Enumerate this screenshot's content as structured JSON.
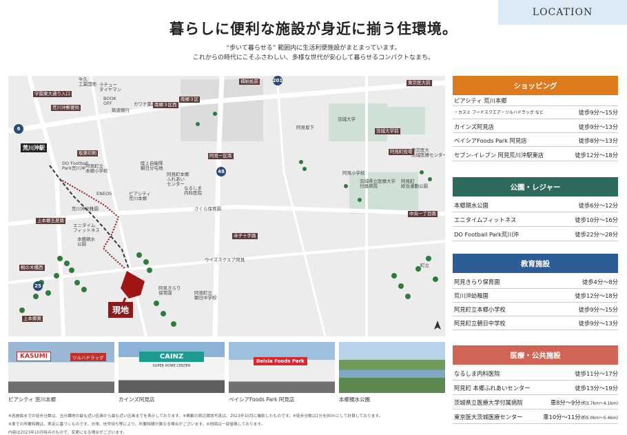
{
  "header": {
    "location_tab": "LOCATION",
    "headline": "暮らしに便利な施設が身近に揃う住環境。",
    "subline1": "“歩いて暮らせる” 範囲内に生活利便施設がまとまっています。",
    "subline2": "これからの時代にこそふさわしい、多様な世代が安心して暮らせるコンパクトなまち。"
  },
  "map": {
    "site_label": "現地",
    "station": "荒川沖駅",
    "routes": [
      "6",
      "48",
      "25",
      "201"
    ],
    "labels": {
      "l1": "牛久\n工業団地",
      "l2": "ラチュー\nタイヤマン",
      "l3": "学園東大通り入口",
      "l4": "荒川沖郵便局",
      "l5": "BOOK\nOFF",
      "l6": "カワチ薬品",
      "l7": "筑波銀行",
      "l8": "南郷３区西",
      "l9": "南郷３区",
      "l10": "阿見町立\n本郷小学校",
      "l11": "坂東印刷",
      "l12": "DO Football\nPark荒川沖",
      "l13": "ENEOS",
      "l14": "荒川沖幼稚園",
      "l15": "上本郷五差路",
      "l16": "エニタイム\nフィットネス",
      "l17": "本郷親水\n公園",
      "l18": "桐の木橋西",
      "l19": "上本郷東",
      "l20": "陸上自衛隊\n朝日分屯地",
      "l21": "阿見町本郷\nふれあい\nセンター",
      "l22": "ピアシティ\n荒川本郷",
      "l23": "なるしま\n内科医院",
      "l24": "さくら保育園",
      "l25": "寺子十字路",
      "l26": "ウイズスクエア阿見",
      "l27": "阿見きらり\n保育園",
      "l28": "阿見町立\n朝日中学校",
      "l29": "補給処前",
      "l30": "茨城大学",
      "l31": "茨城県立医療大学\n付属病院",
      "l32": "東京医大\n茨城医療センター",
      "l33": "阿見町役場",
      "l34": "阿見町\n総合運動公園",
      "l35": "阿見小学校",
      "l36": "ベイシア\nFoods Park\n阿見店",
      "l37": "カインズ\n阿見店",
      "l38": "セブン‐イレブン\n阿見荒川沖駅東店",
      "l39": "中央一丁目南",
      "l40": "阿見坂下",
      "l41": "阿見",
      "l42": "町立",
      "l43": "茨城大学前",
      "l44": "東京医大前",
      "l45": "阿見一区南"
    }
  },
  "photos": [
    {
      "caption": "ピアシティ 荒川本郷",
      "sign": "KASUMI",
      "sign2": "ツルハドラッグ"
    },
    {
      "caption": "カインズ阿見店",
      "sign": "CAINZ",
      "sign2": "SUPER HOME CENTER"
    },
    {
      "caption": "ベイシアFoods Park 阿見店",
      "sign": "Beisia Foods Park"
    },
    {
      "caption": "本郷親水公園"
    }
  ],
  "notes": {
    "n1": "※各施設までの徒歩分数は、当分譲地の最も近い区画から最も近い区画までを表示しております。※掲載の周辺環境写真は、2023年10月に撮影したものです。※徒歩分数は1分を80mとして計算しております。",
    "n2": "※車での所要時間は、実走に基づくものです。渋滞、信号待ち等により、所要時間が異なる場合がございます。※地図は一部省略しております。",
    "n3": "内容は2023年10月時点のもので、変更になる場合がございます。"
  },
  "categories": [
    {
      "title": "ショッピング",
      "color": "#de7a1e",
      "items": [
        {
          "name": "ピアシティ 荒川本郷",
          "value": ""
        },
        {
          "name": "・カスミ フードスクエア・ツルハドラッグ など",
          "value": "徒歩9分～15分"
        },
        {
          "name": "カインズ阿見店",
          "value": "徒歩9分～13分"
        },
        {
          "name": "ベイシアFoods Park 阿見店",
          "value": "徒歩8分～13分"
        },
        {
          "name": "セブン‐イレブン 阿見荒川沖駅東店",
          "value": "徒歩12分～18分"
        }
      ]
    },
    {
      "title": "公園・レジャー",
      "color": "#2b6a5c",
      "items": [
        {
          "name": "本郷親水公園",
          "value": "徒歩6分～12分"
        },
        {
          "name": "エニタイムフィットネス",
          "value": "徒歩10分～16分"
        },
        {
          "name": "DO Football Park荒川沖",
          "value": "徒歩22分～28分"
        }
      ]
    },
    {
      "title": "教育施設",
      "color": "#2d5d97",
      "items": [
        {
          "name": "阿見きらり保育園",
          "value": "徒歩4分～8分"
        },
        {
          "name": "荒川沖幼稚園",
          "value": "徒歩12分～18分"
        },
        {
          "name": "阿見町立本郷小学校",
          "value": "徒歩9分～15分"
        },
        {
          "name": "阿見町立朝日中学校",
          "value": "徒歩9分～13分"
        }
      ]
    },
    {
      "title": "医療・公共施設",
      "color": "#d26456",
      "items": [
        {
          "name": "なるしま内科医院",
          "value": "徒歩11分～17分"
        },
        {
          "name": "阿見町 本郷ふれあいセンター",
          "value": "徒歩13分～19分"
        },
        {
          "name": "茨城県立医療大学付属病院",
          "value": "車8分～9分",
          "detail": "(約3.7km～4.1km)"
        },
        {
          "name": "東京医大茨城医療センター",
          "value": "車10分～11分",
          "detail": "(約5.0km～5.4km)"
        }
      ]
    }
  ]
}
